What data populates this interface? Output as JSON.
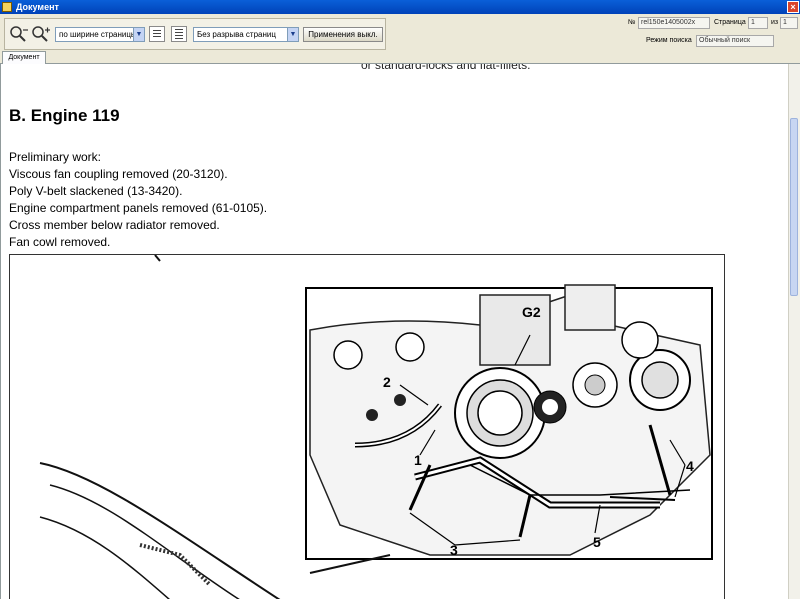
{
  "window": {
    "title": "Документ"
  },
  "toolbar": {
    "zoom_mode": "по ширине страницы",
    "page_break_mode": "Без разрыва страниц",
    "apply_label": "Применения выкл."
  },
  "fields": {
    "number_label": "№",
    "number_value": "rel150e1405002x",
    "page_label": "Страница",
    "page_value": "1",
    "of_label": "из",
    "of_value": "1",
    "search_mode_label": "Режим поиска",
    "search_mode_value": "Обычный поиск"
  },
  "tabs": [
    {
      "label": "Документ"
    }
  ],
  "document": {
    "top_clipped": "or standard-locks and flat-fillets.",
    "heading": "B. Engine 119",
    "paragraphs": [
      "Preliminary work:",
      "Viscous fan coupling removed (20-3120).",
      "Poly V-belt slackened (13-3420).",
      "Engine compartment panels removed (61-0105).",
      "Cross member below radiator removed.",
      "Fan cowl removed."
    ],
    "figure_labels": {
      "g2": "G2",
      "l1": "1",
      "l2": "2",
      "l3": "3",
      "l4": "4",
      "l5": "5"
    }
  }
}
